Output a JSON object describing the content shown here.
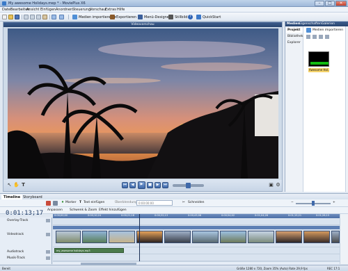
{
  "window": {
    "title": "My awesome Holidays.mep * - MoviePlus X6"
  },
  "menu": [
    "Datei",
    "Bearbeiten",
    "Ansicht",
    "Einfügen",
    "Anordnen",
    "Steuerung",
    "Vorschau",
    "Extras",
    "Hilfe"
  ],
  "toolbar": {
    "import_label": "Medien importieren",
    "export_label": "Exportieren",
    "menu_designer_label": "Menü-Designer",
    "still_label": "Stillbild",
    "quickstart_label": "QuickStart"
  },
  "preview": {
    "header": "Videovorschau"
  },
  "right_panel": {
    "tabs": [
      "Medien",
      "Eigenschaften",
      "Galerien"
    ],
    "side_items": [
      "Projekt",
      "Bibliothek",
      "Explorer"
    ],
    "import_label": "Medien importieren",
    "thumb_label": "Awesome Hol..."
  },
  "timeline": {
    "tabs": [
      "Timeline",
      "Storyboard"
    ],
    "marker_label": "Marker",
    "text_label": "Text einfügen",
    "transition_label": "Überblendung",
    "transition_time": "0:00:00:00",
    "cut_label": "Schneiden",
    "adjust_label": "Anpassen",
    "pan_zoom_label": "Schwenk & Zoom",
    "effect_label": "Effekt hinzufügen",
    "timecode": "0:01:13;17",
    "ruler": [
      "0:00;00;00",
      "0:00;10;24",
      "0:00;21;18",
      "0:00;32;13",
      "0:00;43;08",
      "0:00;54;02",
      "0:01;04;26",
      "0:01;15;21",
      "0:01;26;15"
    ],
    "tracks": [
      "Overlay-Track",
      "Videotrack",
      "Audiotrack",
      "Musik-Track"
    ],
    "audio_caption": "my_awesome holidays.mp3"
  },
  "status": {
    "left": "Bereit",
    "right": "Größe 1280 x 720, Zoom 35% (Auto)  Rate 29,9 fps",
    "rec": "REC 17:1"
  },
  "colors": {
    "accent": "#27446f",
    "title_bar": "#9fb9d9",
    "highlight": "#f5d36a"
  }
}
